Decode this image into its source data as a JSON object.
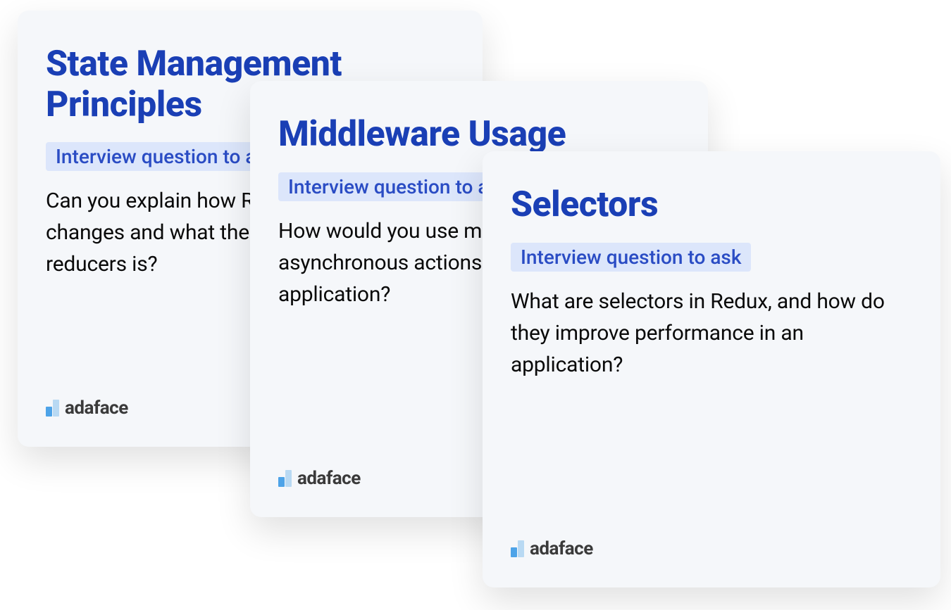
{
  "cards": [
    {
      "title": "State Management Principles",
      "badge": "Interview question to ask",
      "question": "Can you explain how Redux handles state changes and what the role of actions and reducers is?"
    },
    {
      "title": "Middleware Usage",
      "badge": "Interview question to ask",
      "question": "How would you use middleware to handle asynchronous actions in a Redux application?"
    },
    {
      "title": "Selectors",
      "badge": "Interview question to ask",
      "question": "What are selectors in Redux, and how do they improve performance in an application?"
    }
  ],
  "brand": {
    "name": "adaface"
  }
}
